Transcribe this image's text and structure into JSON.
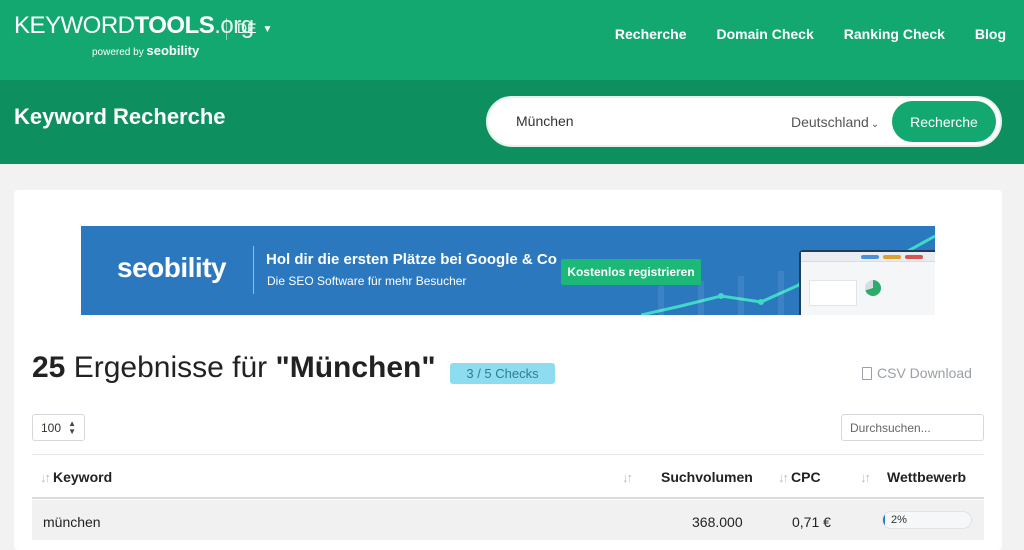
{
  "header": {
    "logo_keyword": "KEYWORD",
    "logo_tools": "TOOLS",
    "logo_org": ".org",
    "logo_powered": "powered by ",
    "logo_brand": "seobility",
    "lang": "DE",
    "nav": [
      "Recherche",
      "Domain Check",
      "Ranking Check",
      "Blog"
    ]
  },
  "search": {
    "title": "Keyword Recherche",
    "query": "München",
    "country": "Deutschland",
    "button": "Recherche"
  },
  "banner": {
    "brand": "seobility",
    "headline": "Hol dir die ersten Plätze bei Google & Co",
    "subline": "Die SEO Software für mehr Besucher",
    "cta": "Kostenlos registrieren",
    "colors": {
      "background": "#2c78bf",
      "cta": "#1bb877"
    }
  },
  "results": {
    "count": "25",
    "label": " Ergebnisse für ",
    "query_quoted": "\"München\"",
    "checks": "3 / 5 Checks",
    "csv": "CSV Download"
  },
  "controls": {
    "page_size": "100",
    "filter_placeholder": "Durchsuchen..."
  },
  "table": {
    "columns": [
      "Keyword",
      "Suchvolumen",
      "CPC",
      "Wettbewerb"
    ],
    "rows": [
      {
        "keyword": "münchen",
        "volume": "368.000",
        "cpc": "0,71 €",
        "competition": "2%",
        "competition_value": 0.02
      }
    ]
  },
  "colors": {
    "topbar": "#14a871",
    "band": "#0e8f5f",
    "accent": "#14a871",
    "checks_badge": "#8edcef"
  }
}
